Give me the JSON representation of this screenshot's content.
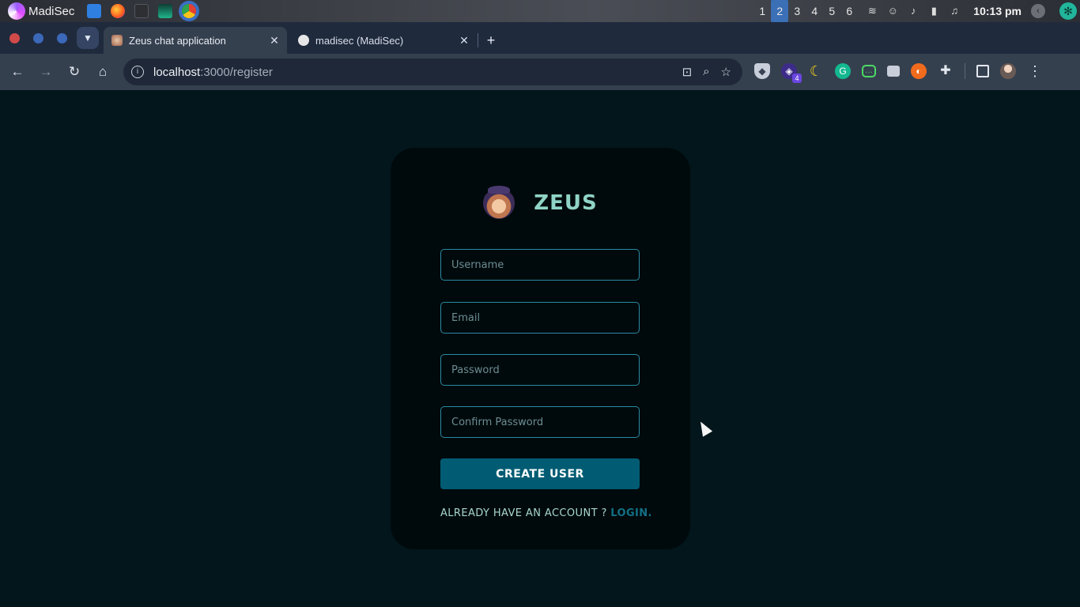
{
  "os_panel": {
    "user_name": "MadiSec",
    "workspaces": [
      "1",
      "2",
      "3",
      "4",
      "5",
      "6"
    ],
    "active_workspace": "2",
    "clock": "10:13 pm"
  },
  "browser": {
    "tabs": [
      {
        "label": "Zeus chat application",
        "active": true
      },
      {
        "label": "madisec (MadiSec)",
        "active": false
      }
    ],
    "url_host": "localhost",
    "url_path": ":3000/register",
    "extension_badge": "4"
  },
  "page": {
    "brand_name": "ZEUS",
    "fields": {
      "username_placeholder": "Username",
      "email_placeholder": "Email",
      "password_placeholder": "Password",
      "confirm_password_placeholder": "Confirm Password"
    },
    "create_button_label": "CREATE USER",
    "login_prompt": "ALREADY HAVE AN ACCOUNT ? ",
    "login_link_label": "LOGIN."
  },
  "colors": {
    "page_background": "#02161b",
    "card_background": "#000a0c",
    "brand_text": "#8fd4c6",
    "field_border": "#2a8aa3",
    "button_background": "#015c73",
    "link_color": "#136f85"
  }
}
